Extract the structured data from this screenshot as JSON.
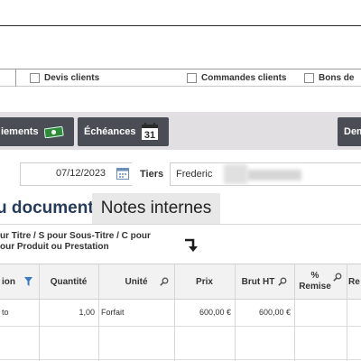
{
  "filters": {
    "devis_label": "Devis clients",
    "commandes_label": "Commandes clients",
    "bons_label": "Bons de"
  },
  "toolbar": {
    "paiements_label": "iements",
    "echeances_label": "Échéances",
    "echeances_day": "31",
    "dem_label": "Dem"
  },
  "form": {
    "date_value": "07/12/2023",
    "tiers_label": "Tiers",
    "tiers_value": "Frederic"
  },
  "tabs": [
    {
      "label": "u document",
      "active": true
    },
    {
      "label": "Notes internes",
      "active": false
    }
  ],
  "hint": {
    "line1": "ur Titre / S pour Sous-Titre  / C pour",
    "line2": "our Produit ou Prestation"
  },
  "table": {
    "headers": [
      "ion",
      "Quantité",
      "Unité",
      "Prix",
      "Brut HT",
      "%",
      "Remise",
      "Re"
    ],
    "rows": [
      {
        "designation": "to",
        "quantite": "1,00",
        "unite": "Forfait",
        "prix": "600,00 €",
        "brut_ht": "600,00 €"
      }
    ]
  },
  "colors": {
    "toolbar_button": "#4a4d55",
    "toolbar_band": "#e2dfe3",
    "active_tab_text": "#263c5c",
    "filter_icon": "#3a78c8"
  },
  "icons": [
    "money-icon",
    "calendar-icon",
    "down-right-arrow-icon",
    "filter-icon",
    "magnifier-icon"
  ]
}
